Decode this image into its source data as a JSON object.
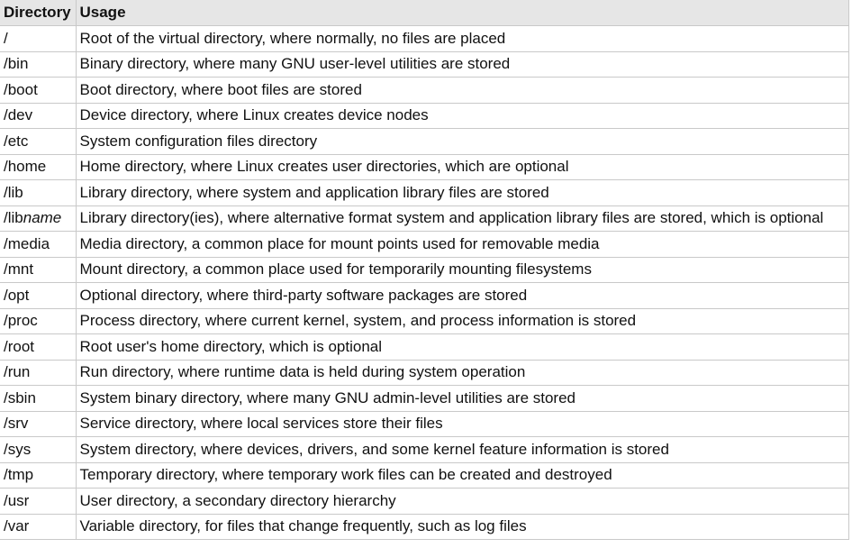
{
  "table": {
    "headers": [
      "Directory",
      "Usage"
    ],
    "rows": [
      {
        "dir": "/",
        "usage": "Root of the virtual directory, where normally, no files are placed"
      },
      {
        "dir": "/bin",
        "usage": "Binary directory, where many GNU user-level utilities are stored"
      },
      {
        "dir": "/boot",
        "usage": "Boot directory, where boot files are stored"
      },
      {
        "dir": "/dev",
        "usage": "Device directory, where Linux creates device nodes"
      },
      {
        "dir": "/etc",
        "usage": "System configuration files directory"
      },
      {
        "dir": "/home",
        "usage": "Home directory, where Linux creates user directories, which are optional"
      },
      {
        "dir": "/lib",
        "usage": "Library directory, where system and application library files are stored"
      },
      {
        "dir": "/lib",
        "dir_suffix": "name",
        "usage": "Library directory(ies), where alternative format system and application library files are stored, which is optional"
      },
      {
        "dir": "/media",
        "usage": "Media directory, a common place for mount points used for removable media"
      },
      {
        "dir": "/mnt",
        "usage": "Mount directory, a common place used for temporarily mounting filesystems"
      },
      {
        "dir": "/opt",
        "usage": "Optional directory, where third-party software packages are stored"
      },
      {
        "dir": "/proc",
        "usage": "Process directory, where current kernel, system, and process information is stored"
      },
      {
        "dir": "/root",
        "usage": "Root user's home directory, which is optional"
      },
      {
        "dir": "/run",
        "usage": "Run directory, where runtime data is held during system operation"
      },
      {
        "dir": "/sbin",
        "usage": "System binary directory, where many GNU admin-level utilities are stored"
      },
      {
        "dir": "/srv",
        "usage": "Service directory, where local services store their files"
      },
      {
        "dir": "/sys",
        "usage": "System directory, where devices, drivers, and some kernel feature information is stored"
      },
      {
        "dir": "/tmp",
        "usage": "Temporary directory, where temporary work files can be created and destroyed"
      },
      {
        "dir": "/usr",
        "usage": "User directory, a secondary directory hierarchy"
      },
      {
        "dir": "/var",
        "usage": "Variable directory, for files that change frequently, such as log files"
      }
    ]
  }
}
